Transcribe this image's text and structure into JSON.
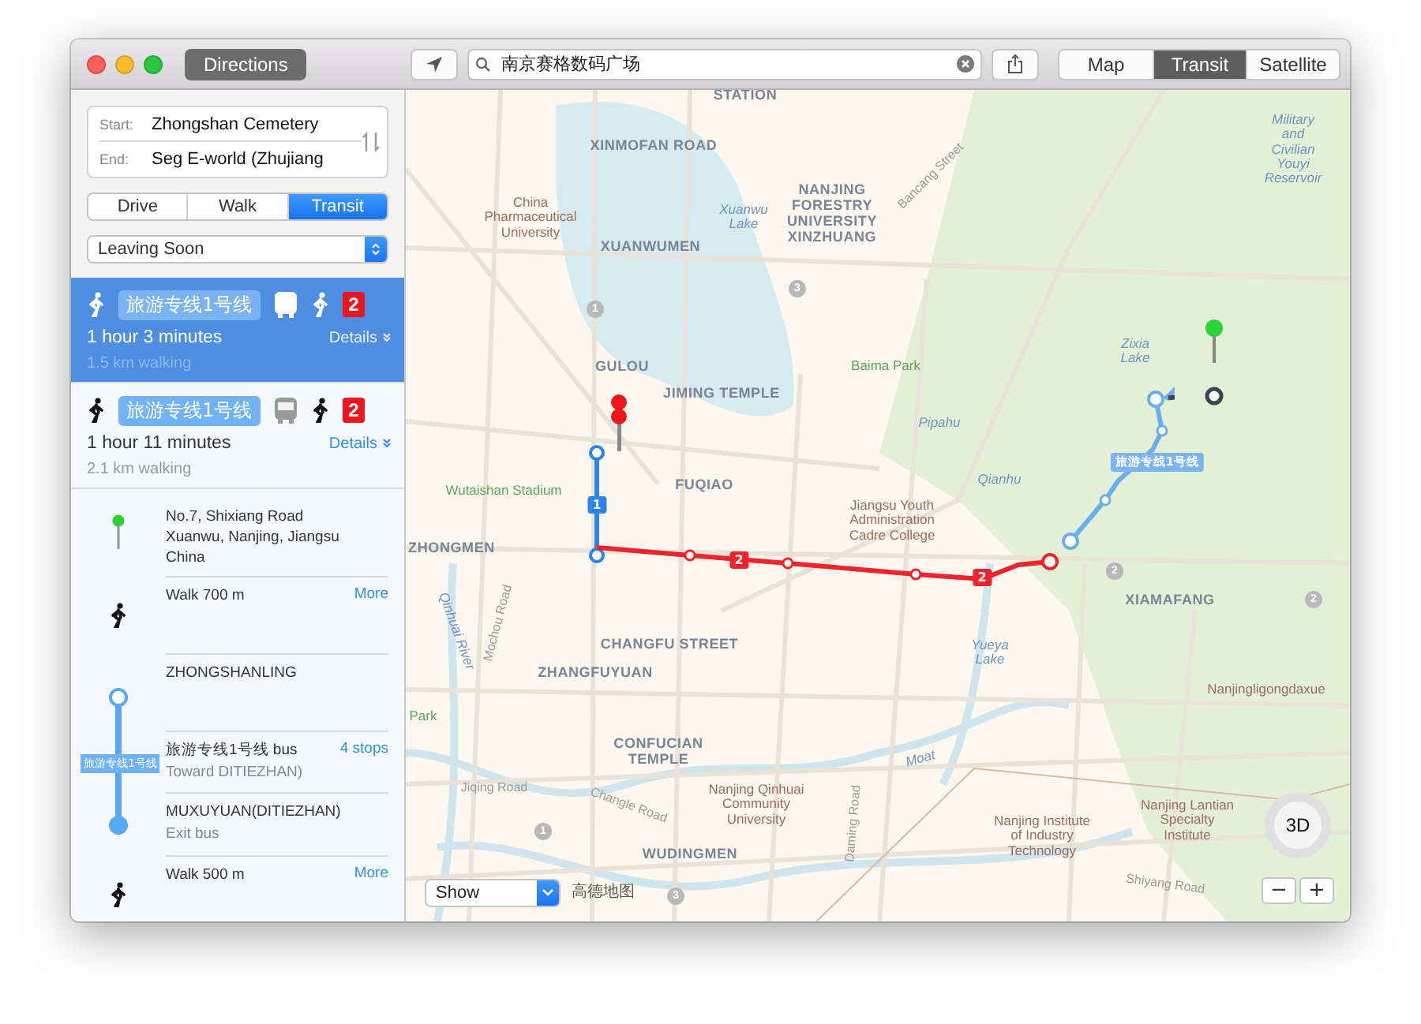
{
  "window": {
    "directions_button": "Directions",
    "search": {
      "value": "南京赛格数码广场"
    },
    "view_tabs": [
      {
        "label": "Map",
        "selected": false
      },
      {
        "label": "Transit",
        "selected": true
      },
      {
        "label": "Satellite",
        "selected": false
      }
    ]
  },
  "sidebar": {
    "start": {
      "label": "Start:",
      "value": "Zhongshan Cemetery"
    },
    "end": {
      "label": "End:",
      "value": "Seg E-world (Zhujiang"
    },
    "modes": [
      {
        "label": "Drive",
        "selected": false
      },
      {
        "label": "Walk",
        "selected": false
      },
      {
        "label": "Transit",
        "selected": true
      }
    ],
    "time_select": "Leaving Soon",
    "routes": [
      {
        "selected": true,
        "line": "旅游专线1号线",
        "badge": "2",
        "duration": "1 hour 3 minutes",
        "details": "Details",
        "walking": "1.5 km walking"
      },
      {
        "selected": false,
        "line": "旅游专线1号线",
        "badge": "2",
        "duration": "1 hour 11 minutes",
        "details": "Details",
        "walking": "2.1 km walking"
      }
    ],
    "steps": [
      {
        "kind": "start",
        "title": "No.7, Shixiang Road Xuanwu, Nanjing, Jiangsu China"
      },
      {
        "kind": "walk",
        "title": "Walk 700 m",
        "link": "More"
      },
      {
        "kind": "board",
        "title": "ZHONGSHANLING"
      },
      {
        "kind": "ride",
        "title": "旅游专线1号线 bus",
        "subtitle": "Toward DITIEZHAN)",
        "link": "4 stops",
        "line": "旅游专线1号线"
      },
      {
        "kind": "exit",
        "title": "MUXUYUAN(DITIEZHAN)",
        "subtitle": "Exit bus"
      },
      {
        "kind": "walk",
        "title": "Walk 500 m",
        "link": "More"
      }
    ]
  },
  "map": {
    "labels": [
      {
        "text": "STATION",
        "kind": "station"
      },
      {
        "text": "XINMOFAN ROAD",
        "kind": "station"
      },
      {
        "text": "China\nPharmaceutical\nUniversity",
        "kind": "poi"
      },
      {
        "text": "XUANWUMEN",
        "kind": "station"
      },
      {
        "text": "Xuanwu\nLake",
        "kind": "water"
      },
      {
        "text": "NANJING\nFORESTRY\nUNIVERSITY\nXINZHUANG",
        "kind": "station"
      },
      {
        "text": "Bancang Street",
        "kind": "street"
      },
      {
        "text": "Military\nand\nCivilian\nYouyi\nReservoir",
        "kind": "water"
      },
      {
        "text": "GULOU",
        "kind": "station"
      },
      {
        "text": "JIMING TEMPLE",
        "kind": "station"
      },
      {
        "text": "Baima Park",
        "kind": "park"
      },
      {
        "text": "Zixia\nLake",
        "kind": "water"
      },
      {
        "text": "Pipahu",
        "kind": "water"
      },
      {
        "text": "Wutaishan Stadium",
        "kind": "park"
      },
      {
        "text": "FUQIAO",
        "kind": "station"
      },
      {
        "text": "Jiangsu Youth\nAdministration\nCadre College",
        "kind": "poi"
      },
      {
        "text": "Qianhu",
        "kind": "water"
      },
      {
        "text": "ZHONGMEN",
        "kind": "station"
      },
      {
        "text": "XIAMAFANG",
        "kind": "station"
      },
      {
        "text": "CHANGFU STREET",
        "kind": "station"
      },
      {
        "text": "ZHANGFUYUAN",
        "kind": "station"
      },
      {
        "text": "Yueya\nLake",
        "kind": "water"
      },
      {
        "text": "Nanjingligongdaxue",
        "kind": "poi"
      },
      {
        "text": "Qinhuai River",
        "kind": "water"
      },
      {
        "text": "Mochou Road",
        "kind": "street"
      },
      {
        "text": "CONFUCIAN\nTEMPLE",
        "kind": "station"
      },
      {
        "text": "Moat",
        "kind": "water"
      },
      {
        "text": "Jiqing Road",
        "kind": "street"
      },
      {
        "text": "Changle Road",
        "kind": "street"
      },
      {
        "text": "Nanjing Qinhuai\nCommunity\nUniversity",
        "kind": "poi"
      },
      {
        "text": "Daming Road",
        "kind": "street"
      },
      {
        "text": "Nanjing Institute\nof Industry\nTechnology",
        "kind": "poi"
      },
      {
        "text": "Nanjing Lantian\nSpecialty\nInstitute",
        "kind": "poi"
      },
      {
        "text": "Shiyang Road",
        "kind": "street"
      },
      {
        "text": "WUDINGMEN",
        "kind": "station"
      },
      {
        "text": "Park",
        "kind": "park"
      },
      {
        "text": "3",
        "kind": "route_number"
      },
      {
        "text": "1",
        "kind": "route_number"
      },
      {
        "text": "2",
        "kind": "route_number"
      },
      {
        "text": "2",
        "kind": "route_number"
      },
      {
        "text": "1",
        "kind": "route_number"
      },
      {
        "text": "3",
        "kind": "route_number"
      }
    ],
    "line_badges": [
      {
        "text": "1",
        "color": "#2a84f0"
      },
      {
        "text": "2",
        "color": "#f0242c"
      },
      {
        "text": "2",
        "color": "#f0242c"
      },
      {
        "text": "旅游专线1号线",
        "color": "#7ab6f2"
      }
    ],
    "show_select": "Show",
    "provider": "高德地图",
    "compass": "3D",
    "zoom_out": "−",
    "zoom_in": "+"
  }
}
